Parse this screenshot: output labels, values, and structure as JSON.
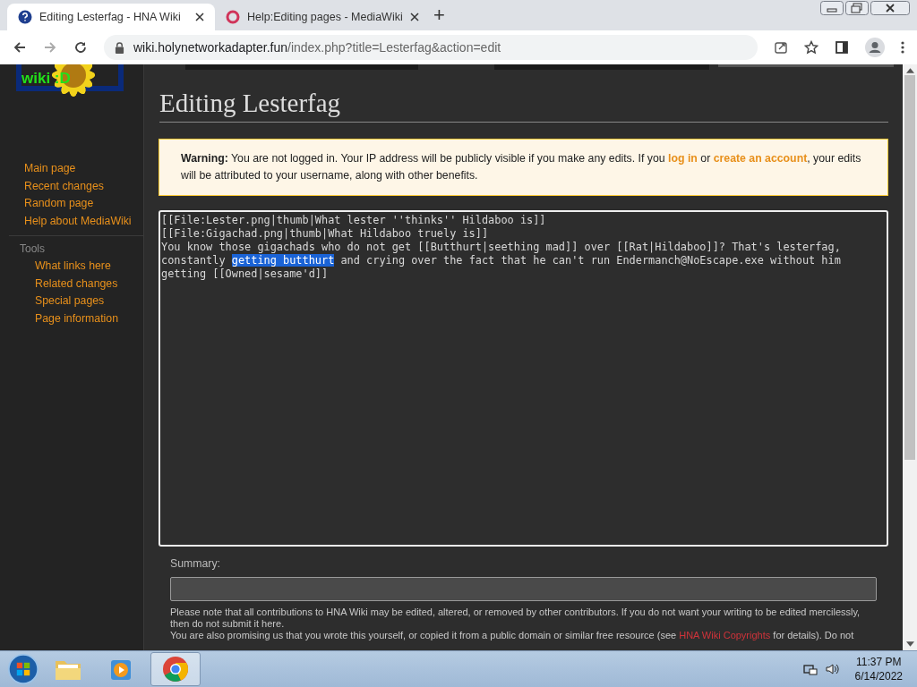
{
  "browser": {
    "tabs": [
      {
        "title": "Editing Lesterfag - HNA Wiki",
        "selected": true
      },
      {
        "title": "Help:Editing pages - MediaWiki",
        "selected": false
      }
    ],
    "url_host": "wiki.holynetworkadapter.fun",
    "url_path": "/index.php?title=Lesterfag&action=edit",
    "new_tab": "+"
  },
  "logo": {
    "text": "wiki :D"
  },
  "sidebar": {
    "navigation": [
      "Main page",
      "Recent changes",
      "Random page",
      "Help about MediaWiki"
    ],
    "tools_heading": "Tools",
    "tools": [
      "What links here",
      "Related changes",
      "Special pages",
      "Page information"
    ]
  },
  "page": {
    "title": "Editing Lesterfag",
    "warning": [
      {
        "kind": "strong",
        "text": "Warning:"
      },
      {
        "kind": "text",
        "text": " You are not logged in. Your IP address will be publicly visible if you make any edits. If you "
      },
      {
        "kind": "link",
        "text": "log in"
      },
      {
        "kind": "text",
        "text": " or "
      },
      {
        "kind": "link",
        "text": "create an account"
      },
      {
        "kind": "text",
        "text": ", your edits will be attributed to your username, along with other benefits."
      }
    ],
    "editor": [
      {
        "text": "[[File:Lester.png|thumb|What lester ''thinks'' Hildaboo is]]\n[[File:Gigachad.png|thumb|What Hildaboo truely is]]\nYou know those gigachads who do not get [[Butthurt|seething mad]] over [[Rat|Hildaboo]]? That's lesterfag, constantly ",
        "selected": false
      },
      {
        "text": "getting butthurt",
        "selected": true
      },
      {
        "text": " and crying over the fact that he can't run Endermanch@NoEscape.exe without him getting [[Owned|sesame'd]]",
        "selected": false
      }
    ],
    "summary_label": "Summary:",
    "notice_1": "Please note that all contributions to HNA Wiki may be edited, altered, or removed by other contributors. If you do not want your writing to be edited mercilessly, then do not submit it here.",
    "notice_2": [
      {
        "kind": "text",
        "text": "You are also promising us that you wrote this yourself, or copied it from a public domain or similar free resource (see "
      },
      {
        "kind": "link",
        "text": "HNA Wiki Copyrights"
      },
      {
        "kind": "text",
        "text": " for details). Do not"
      }
    ]
  },
  "taskbar": {
    "time": "11:37 PM",
    "date": "6/14/2022"
  }
}
